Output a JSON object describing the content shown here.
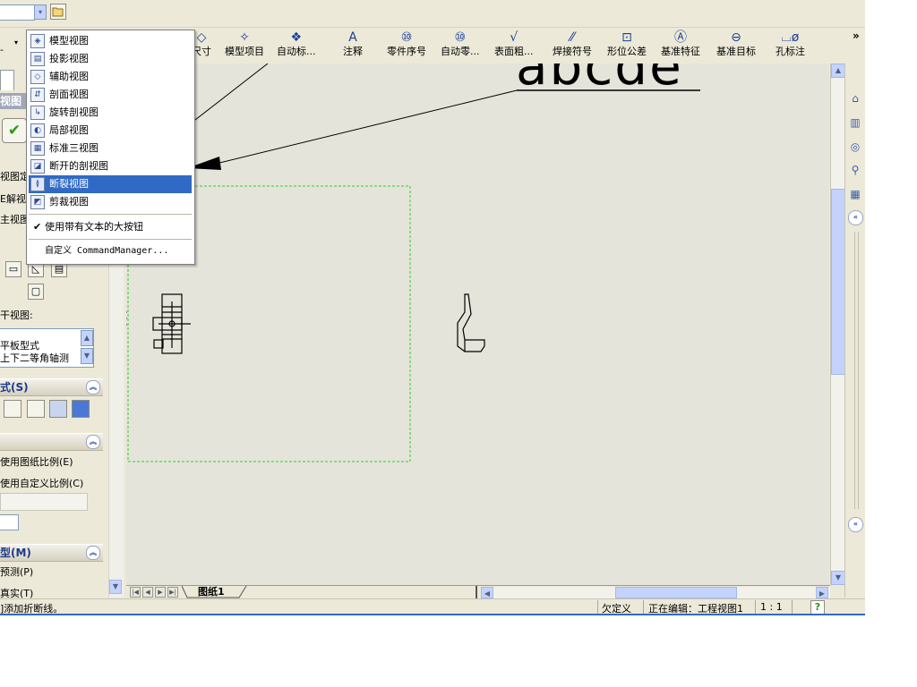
{
  "top_toolbar": {
    "combo_value": "",
    "combo_arrow": "▾",
    "folder_icon": "folder-open-icon"
  },
  "command_bar": {
    "items": [
      {
        "label": "尺寸",
        "icon": "smart-dimension-icon",
        "glyph": "◇"
      },
      {
        "label": "模型项目",
        "icon": "model-items-icon",
        "glyph": "✧"
      },
      {
        "label": "自动标...",
        "icon": "auto-dimension-icon",
        "glyph": "❖"
      },
      {
        "label": "注释",
        "icon": "note-icon",
        "glyph": "A"
      },
      {
        "label": "零件序号",
        "icon": "balloon-icon",
        "glyph": "⑩"
      },
      {
        "label": "自动零...",
        "icon": "auto-balloon-icon",
        "glyph": "⑩"
      },
      {
        "label": "表面粗...",
        "icon": "surface-finish-icon",
        "glyph": "√"
      },
      {
        "label": "焊接符号",
        "icon": "weld-symbol-icon",
        "glyph": "⁄⁄"
      },
      {
        "label": "形位公差",
        "icon": "geometric-tolerance-icon",
        "glyph": "⊡"
      },
      {
        "label": "基准特征",
        "icon": "datum-feature-icon",
        "glyph": "Ⓐ"
      },
      {
        "label": "基准目标",
        "icon": "datum-target-icon",
        "glyph": "⊖"
      },
      {
        "label": "孔标注",
        "icon": "hole-callout-icon",
        "glyph": "⌴ø"
      }
    ],
    "more": "»"
  },
  "view_menu": {
    "items": [
      {
        "label": "模型视图",
        "icon": "model-view-icon",
        "glyph": "◈"
      },
      {
        "label": "投影视图",
        "icon": "projected-view-icon",
        "glyph": "▤"
      },
      {
        "label": "辅助视图",
        "icon": "auxiliary-view-icon",
        "glyph": "◇"
      },
      {
        "label": "剖面视图",
        "icon": "section-view-icon",
        "glyph": "⇵"
      },
      {
        "label": "旋转剖视图",
        "icon": "aligned-section-icon",
        "glyph": "↳"
      },
      {
        "label": "局部视图",
        "icon": "detail-view-icon",
        "glyph": "◐"
      },
      {
        "label": "标准三视图",
        "icon": "standard-3-view-icon",
        "glyph": "▦"
      },
      {
        "label": "断开的剖视图",
        "icon": "broken-out-section-icon",
        "glyph": "◪"
      },
      {
        "label": "断裂视图",
        "icon": "break-view-icon",
        "glyph": "≬"
      },
      {
        "label": "剪裁视图",
        "icon": "crop-view-icon",
        "glyph": "◩"
      }
    ],
    "selected_index": 8,
    "large_buttons_check": "✔",
    "large_buttons_label": "使用带有文本的大按钮",
    "customize_label": "自定义 CommandManager..."
  },
  "left_panel": {
    "title": "视图",
    "ok_glyph": "✔",
    "lines": [
      "视图定",
      "E解视",
      "主视图"
    ],
    "orientation_label": "干视图:",
    "list_items": [
      "平板型式",
      "上下二等角轴测"
    ],
    "display_style_header": "式(S)",
    "scale_options": [
      "使用图纸比例(E)",
      "使用自定义比例(C)"
    ],
    "thread_header": "型(M)",
    "thread_options": [
      "预测(P)",
      "真实(T)"
    ],
    "chevron": "︽"
  },
  "canvas": {
    "title_text": "abcde"
  },
  "sheet_bar": {
    "nav": [
      "|◀",
      "◀",
      "▶",
      "▶|"
    ],
    "sheet_name": "图纸1"
  },
  "status_bar": {
    "message": "]添加折断线。",
    "state": "欠定义",
    "editing": "正在编辑：工程视图1",
    "scale": "1 : 1",
    "help": "?"
  },
  "task_pane": {
    "icons": [
      "home-icon",
      "resources-icon",
      "design-library-icon",
      "search-icon",
      "view-palette-icon"
    ]
  },
  "colors": {
    "menu_highlight": "#316ac5",
    "accent_blue": "#3568c6",
    "bg": "#ece9d8",
    "canvas": "#e5e4da"
  }
}
